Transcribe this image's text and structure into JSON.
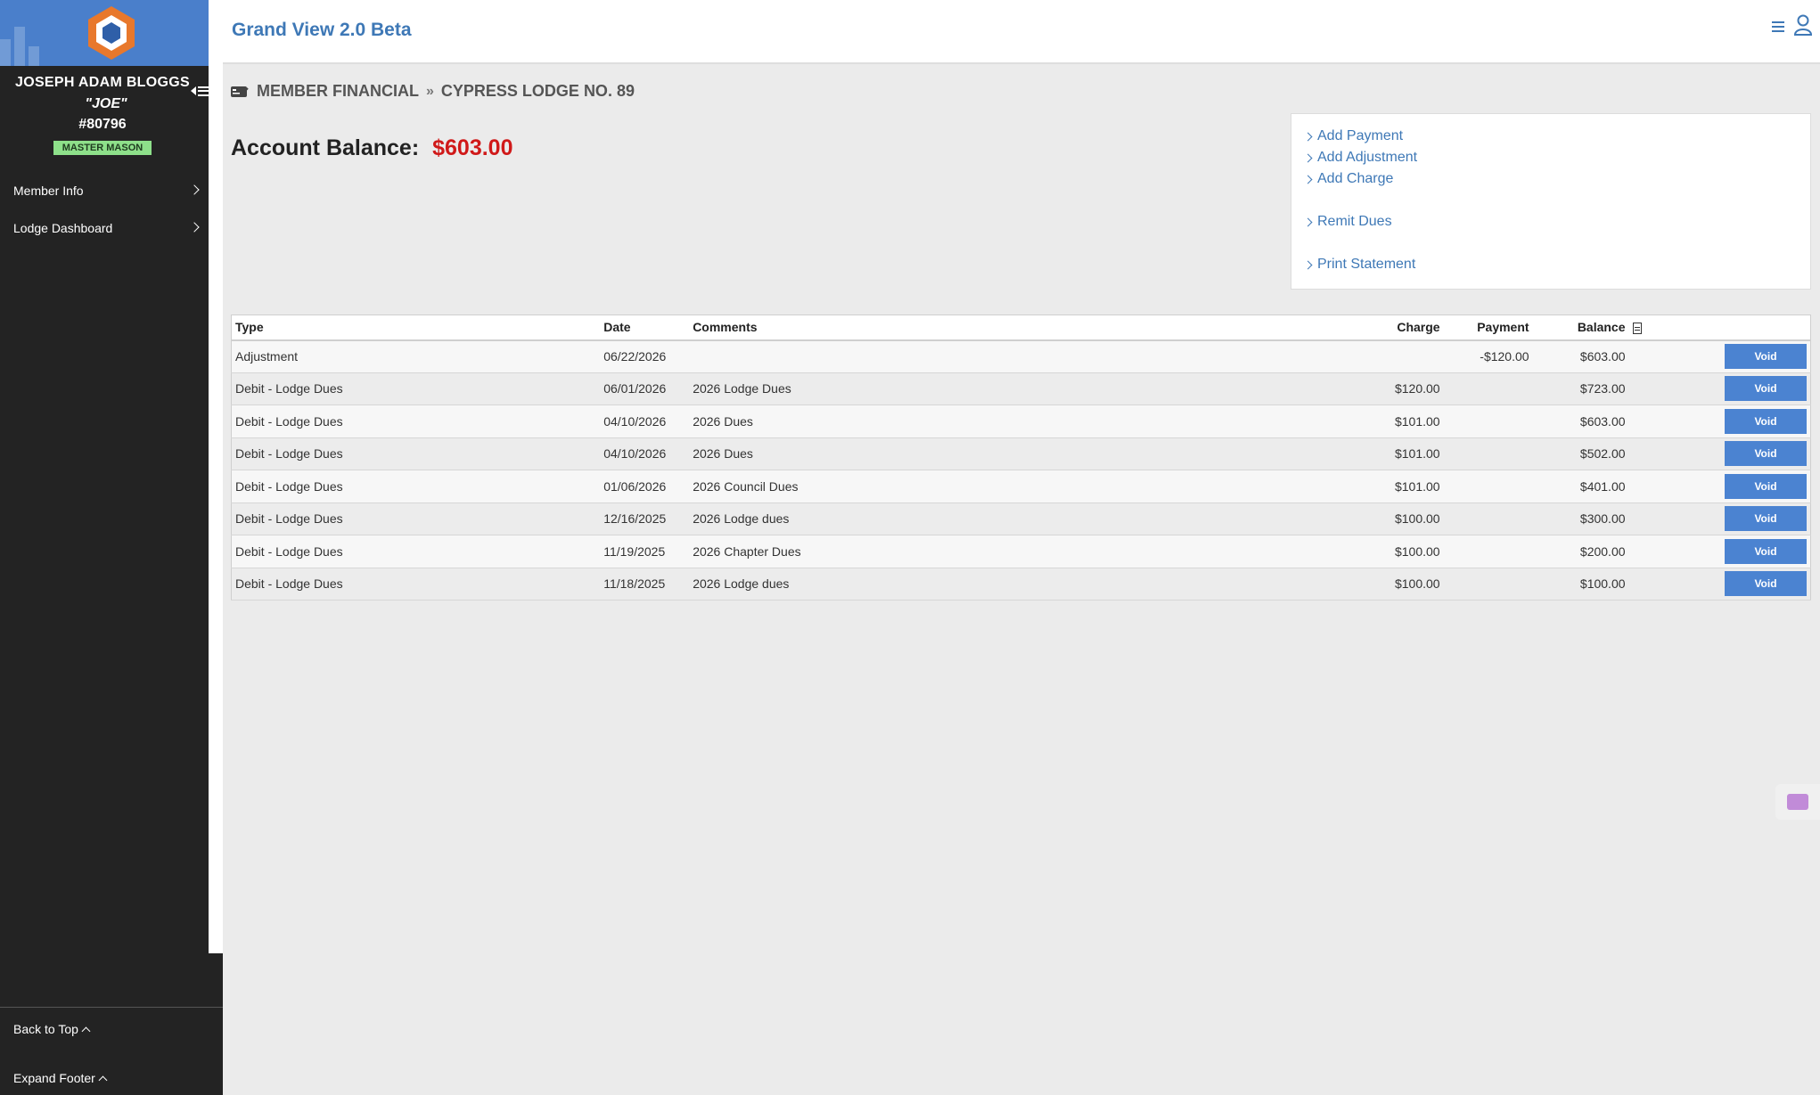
{
  "app": {
    "title": "Grand View 2.0 Beta"
  },
  "member": {
    "name": "JOSEPH ADAM BLOGGS",
    "nickname": "\"JOE\"",
    "number": "#80796",
    "degree": "MASTER MASON"
  },
  "sidebar": {
    "items": [
      {
        "label": "Member Info"
      },
      {
        "label": "Lodge Dashboard"
      }
    ],
    "back_to_top": "Back to Top",
    "expand_footer": "Expand Footer"
  },
  "breadcrumb": {
    "section": "MEMBER FINANCIAL",
    "lodge": "CYPRESS LODGE NO. 89"
  },
  "account": {
    "label": "Account Balance:",
    "balance": "$603.00"
  },
  "actions": {
    "add_payment": "Add Payment",
    "add_adjustment": "Add Adjustment",
    "add_charge": "Add Charge",
    "remit_dues": "Remit Dues",
    "print_statement": "Print Statement"
  },
  "ledger": {
    "headers": {
      "type": "Type",
      "date": "Date",
      "comments": "Comments",
      "charge": "Charge",
      "payment": "Payment",
      "balance": "Balance"
    },
    "void_label": "Void",
    "rows": [
      {
        "type": "Adjustment",
        "date": "06/22/2026",
        "comments": "",
        "charge": "",
        "payment": "-$120.00",
        "balance": "$603.00"
      },
      {
        "type": "Debit - Lodge Dues",
        "date": "06/01/2026",
        "comments": "2026 Lodge Dues",
        "charge": "$120.00",
        "payment": "",
        "balance": "$723.00"
      },
      {
        "type": "Debit - Lodge Dues",
        "date": "04/10/2026",
        "comments": "2026 Dues",
        "charge": "$101.00",
        "payment": "",
        "balance": "$603.00"
      },
      {
        "type": "Debit - Lodge Dues",
        "date": "04/10/2026",
        "comments": "2026 Dues",
        "charge": "$101.00",
        "payment": "",
        "balance": "$502.00"
      },
      {
        "type": "Debit - Lodge Dues",
        "date": "01/06/2026",
        "comments": "2026 Council Dues",
        "charge": "$101.00",
        "payment": "",
        "balance": "$401.00"
      },
      {
        "type": "Debit - Lodge Dues",
        "date": "12/16/2025",
        "comments": "2026 Lodge dues",
        "charge": "$100.00",
        "payment": "",
        "balance": "$300.00"
      },
      {
        "type": "Debit - Lodge Dues",
        "date": "11/19/2025",
        "comments": "2026 Chapter Dues",
        "charge": "$100.00",
        "payment": "",
        "balance": "$200.00"
      },
      {
        "type": "Debit - Lodge Dues",
        "date": "11/18/2025",
        "comments": "2026 Lodge dues",
        "charge": "$100.00",
        "payment": "",
        "balance": "$100.00"
      }
    ]
  },
  "colors": {
    "brand_blue": "#3e78b6",
    "balance_red": "#d01919",
    "sidebar_bg": "#232323",
    "badge_green": "#8ee08a"
  },
  "icons": [
    "logo-hexagon",
    "hamburger-icon",
    "user-icon",
    "wallet-icon",
    "chevron-right-icon",
    "document-icon",
    "help-icon"
  ]
}
